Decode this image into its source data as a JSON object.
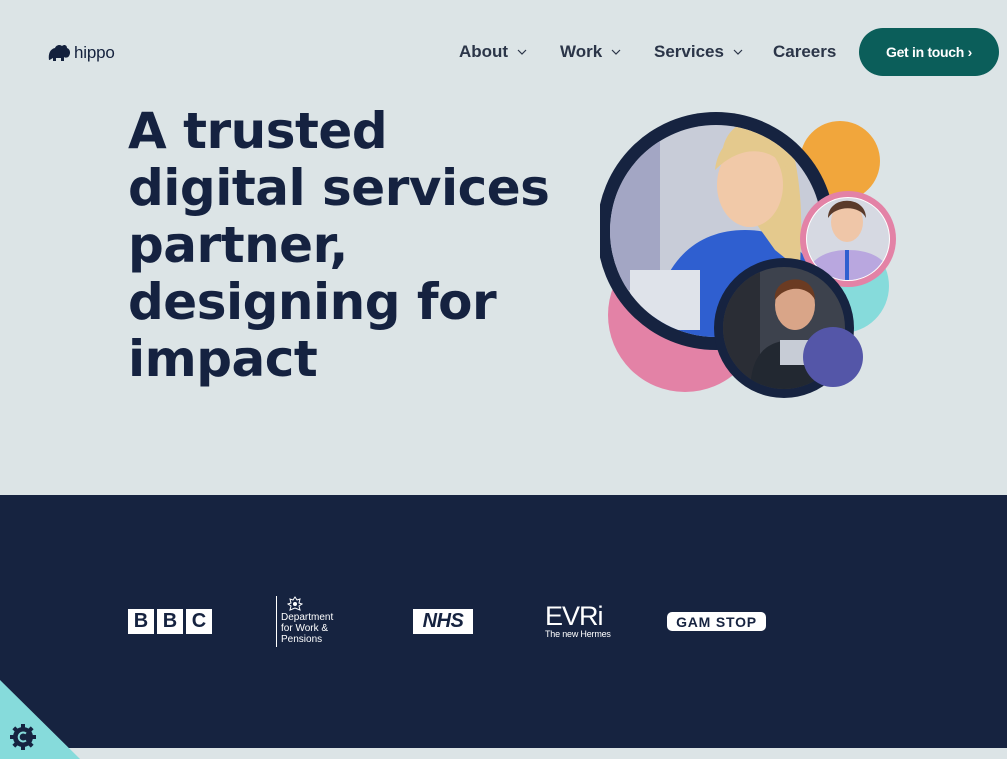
{
  "brand": {
    "name": "hippo",
    "logo_icon": "hippo-icon"
  },
  "nav": {
    "items": [
      {
        "label": "About",
        "has_dropdown": true
      },
      {
        "label": "Work",
        "has_dropdown": true
      },
      {
        "label": "Services",
        "has_dropdown": true
      },
      {
        "label": "Careers",
        "has_dropdown": false
      }
    ],
    "cta_label": "Get in touch ›"
  },
  "hero": {
    "headline": "A trusted digital services partner, designing for impact"
  },
  "clients": {
    "bbc": [
      "B",
      "B",
      "C"
    ],
    "dwp": [
      "Department",
      "for Work &",
      "Pensions"
    ],
    "nhs": "NHS",
    "evri": {
      "name": "EVRi",
      "tagline": "The new Hermes"
    },
    "gamstop": "GAM STOP"
  },
  "cookie": {
    "icon": "cookie-settings-icon"
  },
  "colors": {
    "background": "#dce4e6",
    "navy": "#162340",
    "teal_button": "#0b5e5a",
    "accent_orange": "#f1a63c",
    "accent_pink": "#e382a6",
    "accent_cyan": "#86dbdb",
    "accent_purple": "#5456a8"
  }
}
